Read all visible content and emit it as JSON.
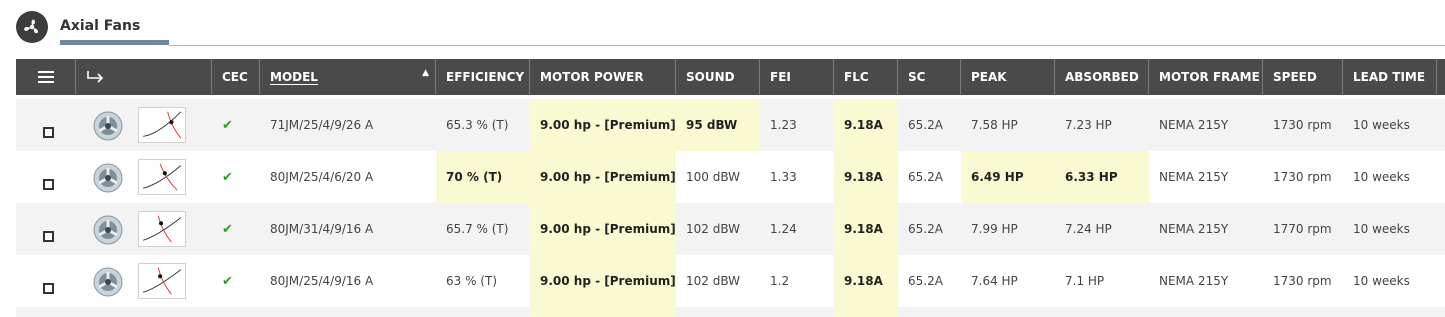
{
  "tab": {
    "title": "Axial Fans",
    "icon": "fan-icon"
  },
  "columns": {
    "menu": "menu-icon",
    "export": "export-arrow-icon",
    "cec": "CEC",
    "model": "MODEL",
    "efficiency": "EFFICIENCY",
    "motor_power": "MOTOR POWER",
    "sound": "SOUND",
    "fei": "FEI",
    "flc": "FLC",
    "sc": "SC",
    "peak": "PEAK",
    "absorbed": "ABSORBED",
    "motor_frame": "MOTOR FRAME",
    "speed": "SPEED",
    "lead_time": "LEAD TIME"
  },
  "sort": {
    "column": "model",
    "direction": "ascending"
  },
  "rows": [
    {
      "cec": "✔",
      "model": "71JM/25/4/9/26 A",
      "efficiency": "65.3 % (T)",
      "motor_power": "9.00 hp - [Premium]",
      "sound": "95 dBW",
      "fei": "1.23",
      "flc": "9.18A",
      "sc": "65.2A",
      "peak": "7.58 HP",
      "absorbed": "7.23 HP",
      "motor_frame": "NEMA 215Y",
      "speed": "1730 rpm",
      "lead_time": "10 weeks"
    },
    {
      "cec": "✔",
      "model": "80JM/25/4/6/20 A",
      "efficiency": "70 % (T)",
      "motor_power": "9.00 hp - [Premium]",
      "sound": "100 dBW",
      "fei": "1.33",
      "flc": "9.18A",
      "sc": "65.2A",
      "peak": "6.49 HP",
      "absorbed": "6.33 HP",
      "motor_frame": "NEMA 215Y",
      "speed": "1730 rpm",
      "lead_time": "10 weeks"
    },
    {
      "cec": "✔",
      "model": "80JM/31/4/9/16 A",
      "efficiency": "65.7 % (T)",
      "motor_power": "9.00 hp - [Premium]",
      "sound": "102 dBW",
      "fei": "1.24",
      "flc": "9.18A",
      "sc": "65.2A",
      "peak": "7.99 HP",
      "absorbed": "7.24 HP",
      "motor_frame": "NEMA 215Y",
      "speed": "1770 rpm",
      "lead_time": "10 weeks"
    },
    {
      "cec": "✔",
      "model": "80JM/25/4/9/16 A",
      "efficiency": "63 % (T)",
      "motor_power": "9.00 hp - [Premium]",
      "sound": "102 dBW",
      "fei": "1.2",
      "flc": "9.18A",
      "sc": "65.2A",
      "peak": "7.64 HP",
      "absorbed": "7.1 HP",
      "motor_frame": "NEMA 215Y",
      "speed": "1730 rpm",
      "lead_time": "10 weeks"
    }
  ],
  "highlight_color": "#fafad2",
  "header_color": "#4a4a4a",
  "accent_color": "#6f87a0"
}
